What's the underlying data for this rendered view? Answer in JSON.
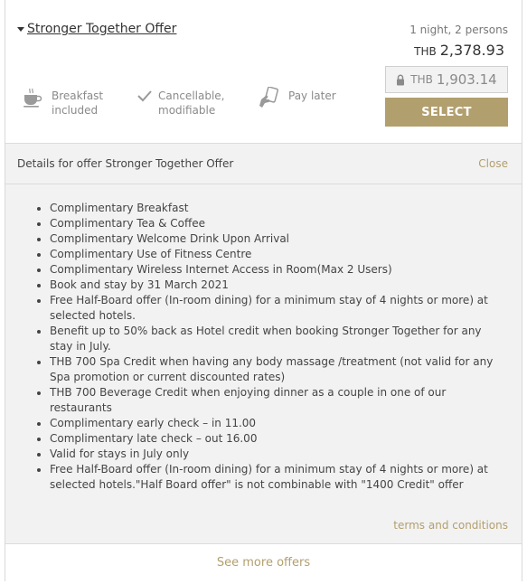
{
  "offer": {
    "title": "Stronger Together Offer",
    "occupancy": "1 night, 2 persons",
    "price_currency": "THB",
    "price_amount": "2,378.93",
    "member_currency": "THB",
    "member_amount": "1,903.14",
    "select_label": "SELECT",
    "features": {
      "breakfast": "Breakfast included",
      "cancellable": "Cancellable, modifiable",
      "pay_later": "Pay later"
    },
    "icons": {
      "breakfast": "coffee-cup-icon",
      "cancellable": "checkmark-icon",
      "pay_later": "hand-card-icon",
      "lock": "lock-icon",
      "caret": "caret-down-icon"
    }
  },
  "details": {
    "title": "Details for offer Stronger Together Offer",
    "close_label": "Close",
    "benefits": [
      "Complimentary Breakfast",
      "Complimentary Tea & Coffee",
      "Complimentary Welcome Drink Upon Arrival",
      "Complimentary Use of Fitness Centre",
      "Complimentary Wireless Internet Access in Room(Max 2 Users)",
      "Book and stay by 31 March 2021",
      "Free Half-Board offer (In-room dining) for a minimum stay of 4 nights or more) at selected hotels.",
      "Benefit up to 50% back as Hotel credit when booking Stronger Together for any stay in July.",
      "THB 700 Spa Credit when having any body massage /treatment (not valid for any Spa promotion or current discounted rates)",
      "THB 700 Beverage Credit when enjoying  dinner as a couple in one of our restaurants",
      "Complimentary early check – in 11.00",
      "Complimentary late check – out 16.00",
      "Valid for stays in July only",
      "Free Half-Board offer (In-room dining) for a minimum stay of 4 nights or more) at selected hotels.\"Half Board offer\" is not combinable with \"1400 Credit\" offer"
    ],
    "terms_label": "terms and conditions"
  },
  "footer": {
    "more_label": "See more offers"
  },
  "colors": {
    "accent": "#b29f6e",
    "panel": "#f2f2f2",
    "border": "#d9d9d9"
  }
}
